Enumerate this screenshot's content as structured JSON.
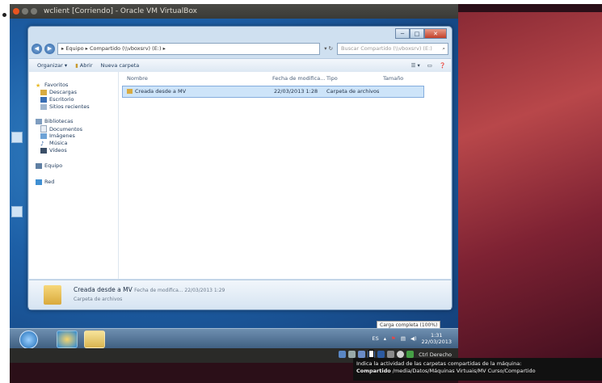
{
  "window": {
    "title": "wclient [Corriendo] - Oracle VM VirtualBox"
  },
  "explorer": {
    "address_path": "▸ Equipo ▸ Compartido (\\\\vboxsrv) (E:) ▸",
    "search_placeholder": "Buscar Compartido (\\\\vboxsrv) (E:)",
    "toolbar": {
      "organize_label": "Organizar ▾",
      "open_label": "Abrir",
      "new_folder_label": "Nueva carpeta"
    },
    "nav": {
      "favorites": "Favoritos",
      "downloads": "Descargas",
      "desktop": "Escritorio",
      "recent": "Sitios recientes",
      "libraries": "Bibliotecas",
      "documents": "Documentos",
      "images": "Imágenes",
      "music": "Música",
      "videos": "Vídeos",
      "computer": "Equipo",
      "network": "Red"
    },
    "columns": {
      "name": "Nombre",
      "modified": "Fecha de modifica...",
      "type": "Tipo",
      "size": "Tamaño"
    },
    "rows": [
      {
        "name": "Creada desde a MV",
        "modified": "22/03/2013 1:28",
        "type": "Carpeta de archivos"
      }
    ],
    "details": {
      "name": "Creada desde a MV",
      "meta": "Fecha de modifica... 22/03/2013 1:29",
      "type": "Carpeta de archivos"
    },
    "tooltip_small": "Carga completa (100%)"
  },
  "taskbar": {
    "clock_time": "1:31",
    "clock_date": "22/03/2013"
  },
  "statusbar": {
    "host_key": "Ctrl Derecho"
  },
  "tooltip": {
    "line1": "Indica la actividad de las carpetas compartidas de la máquina:",
    "line2_label": "Compartido",
    "line2_path": " /media/Datos/Máquinas Virtuais/MV Curso/Compartido"
  },
  "colors": {
    "ubuntu_accent": "#e95420",
    "guest_desktop": "#1d5fa6",
    "selection": "#cde4f9"
  }
}
